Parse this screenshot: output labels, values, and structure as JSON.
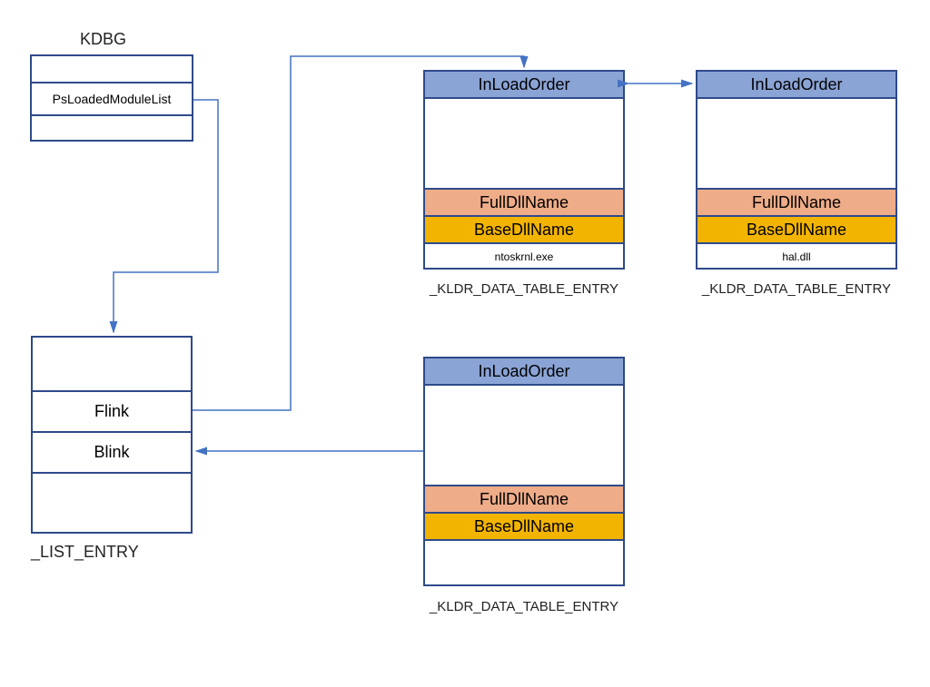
{
  "kdbg": {
    "title": "KDBG",
    "field": "PsLoadedModuleList"
  },
  "listEntry": {
    "typeLabel": "_LIST_ENTRY",
    "flink": "Flink",
    "blink": "Blink"
  },
  "entries": [
    {
      "header": "InLoadOrder",
      "fullDll": "FullDllName",
      "baseDll": "BaseDllName",
      "file": "ntoskrnl.exe",
      "typeLabel": "_KLDR_DATA_TABLE_ENTRY"
    },
    {
      "header": "InLoadOrder",
      "fullDll": "FullDllName",
      "baseDll": "BaseDllName",
      "file": "hal.dll",
      "typeLabel": "_KLDR_DATA_TABLE_ENTRY"
    },
    {
      "header": "InLoadOrder",
      "fullDll": "FullDllName",
      "baseDll": "BaseDllName",
      "file": "",
      "typeLabel": "_KLDR_DATA_TABLE_ENTRY"
    }
  ]
}
